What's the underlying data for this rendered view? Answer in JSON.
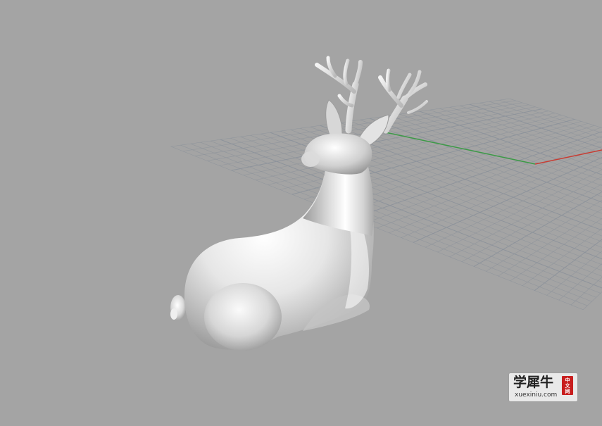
{
  "viewport": {
    "background": "#a4a4a4",
    "grid_color": "#8d939b",
    "axis_x_color": "#c83c32",
    "axis_y_color": "#3c9a46",
    "model": "deer-figurine"
  },
  "watermark": {
    "brand": "学犀牛",
    "seal": [
      "中",
      "文",
      "网"
    ],
    "url": "xuexiniu.com"
  }
}
